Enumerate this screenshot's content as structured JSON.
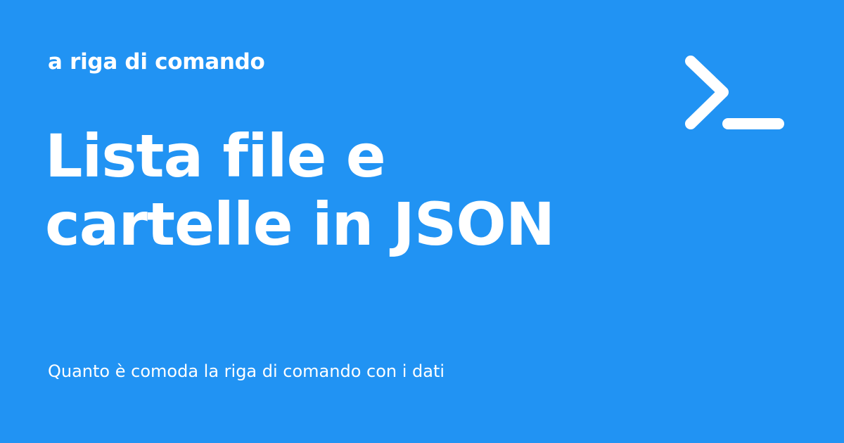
{
  "card": {
    "kicker": "a riga di comando",
    "title_line1": "Lista file e",
    "title_line2": "cartelle in JSON",
    "subtitle": "Quanto è comoda la riga di comando con i dati",
    "icon": "terminal-prompt-icon",
    "background_color": "#2193F3",
    "text_color": "#FFFFFF"
  }
}
